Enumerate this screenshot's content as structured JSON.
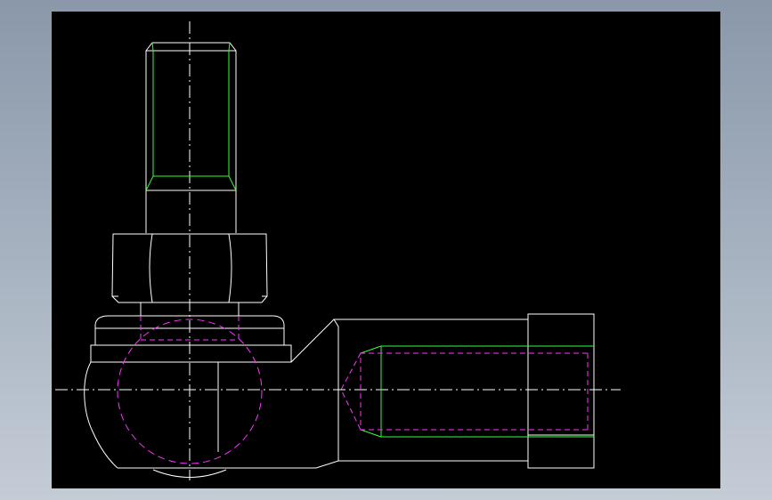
{
  "drawing": {
    "background_color": "#000000",
    "viewport_colors": [
      "#8a98aa",
      "#c4ccd6"
    ],
    "line_colors": {
      "outline": "#ffffff",
      "thread": "#33ff33",
      "hidden": "#ff33ff",
      "centerline": "#ffffff"
    }
  }
}
